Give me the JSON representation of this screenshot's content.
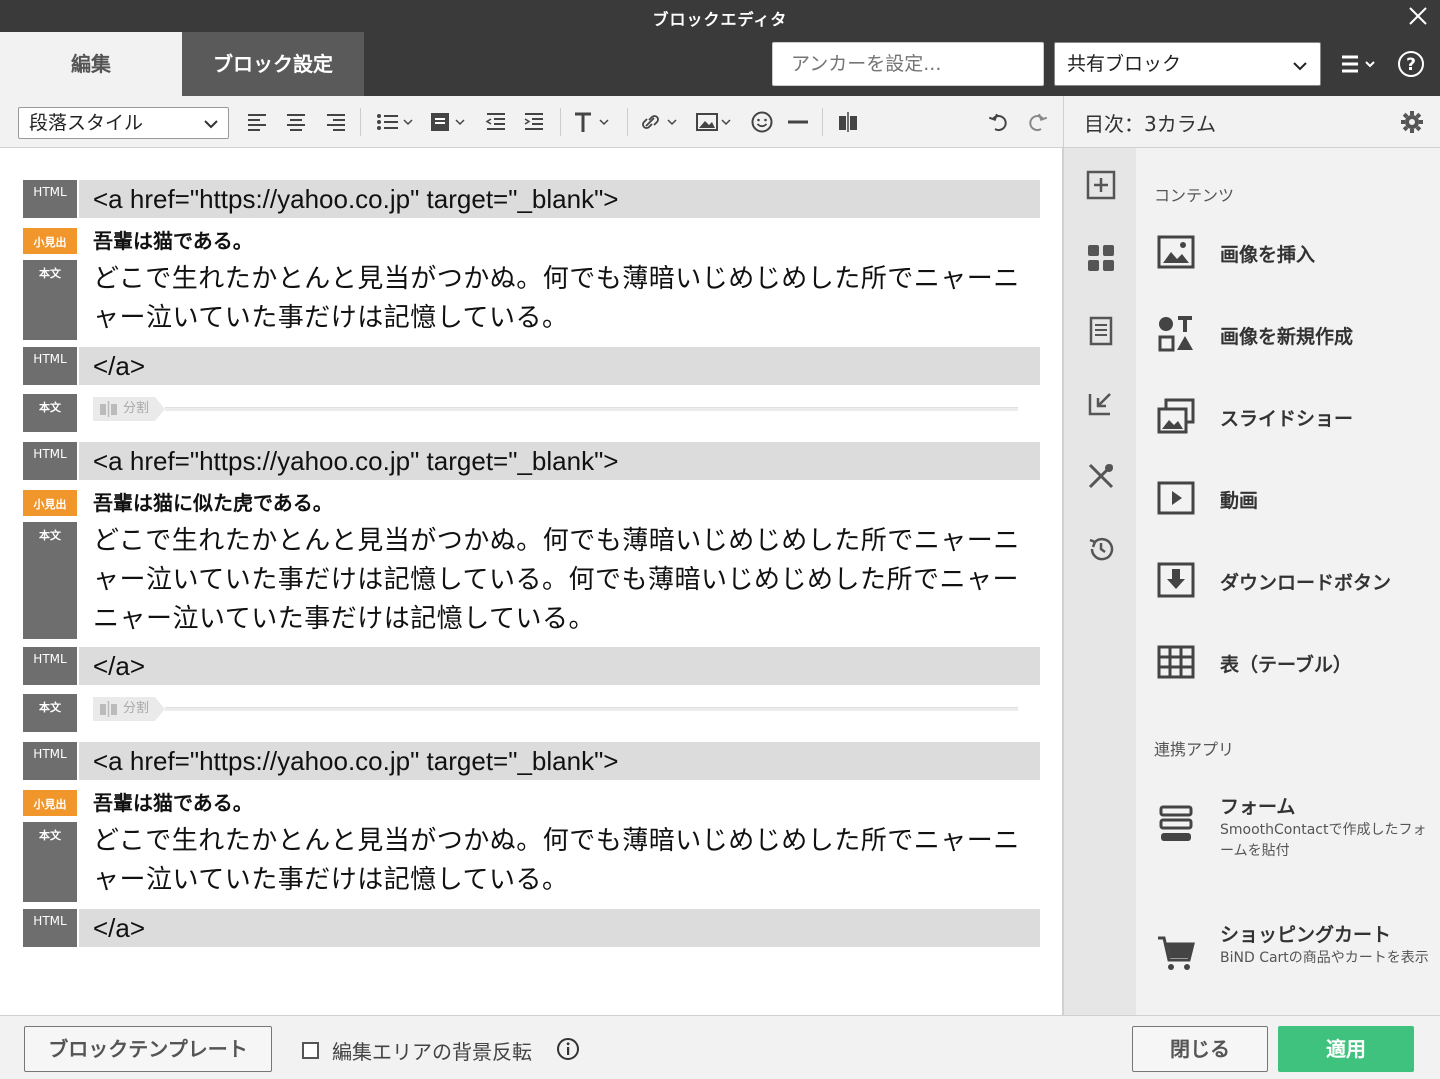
{
  "window": {
    "title": "ブロックエディタ"
  },
  "tabs": {
    "edit": "編集",
    "block_settings": "ブロック設定"
  },
  "anchor": {
    "placeholder": "アンカーを設定..."
  },
  "shared_block": {
    "value": "共有ブロック"
  },
  "toolbar": {
    "paragraph_style": "段落スタイル"
  },
  "right_panel": {
    "header": "目次：3カラム",
    "section_contents": "コンテンツ",
    "items": [
      {
        "label": "画像を挿入",
        "icon": "image-icon"
      },
      {
        "label": "画像を新規作成",
        "icon": "shapes-icon"
      },
      {
        "label": "スライドショー",
        "icon": "slideshow-icon"
      },
      {
        "label": "動画",
        "icon": "video-icon"
      },
      {
        "label": "ダウンロードボタン",
        "icon": "download-icon"
      },
      {
        "label": "表（テーブル）",
        "icon": "table-icon"
      }
    ],
    "section_apps": "連携アプリ",
    "apps": [
      {
        "label": "フォーム",
        "desc": "SmoothContactで作成したフォームを貼付",
        "icon": "form-icon"
      },
      {
        "label": "ショッピングカート",
        "desc": "BiND Cartの商品やカートを表示",
        "icon": "cart-icon"
      }
    ]
  },
  "tags": {
    "html": "HTML",
    "subheading": "小見出",
    "body": "本文",
    "split": "分割"
  },
  "blocks": {
    "a_open": "<a href=\"https://yahoo.co.jp\" target=\"_blank\">",
    "a_close": "</a>",
    "heading1": "吾輩は猫である。",
    "body1": "どこで生れたかとんと見当がつかぬ。何でも薄暗いじめじめした所でニャーニャー泣いていた事だけは記憶している。",
    "heading2": "吾輩は猫に似た虎である。",
    "body2": "どこで生れたかとんと見当がつかぬ。何でも薄暗いじめじめした所でニャーニャー泣いていた事だけは記憶している。何でも薄暗いじめじめした所でニャーニャー泣いていた事だけは記憶している。",
    "heading3": "吾輩は猫である。",
    "body3": "どこで生れたかとんと見当がつかぬ。何でも薄暗いじめじめした所でニャーニャー泣いていた事だけは記憶している。"
  },
  "footer": {
    "template_button": "ブロックテンプレート",
    "invert_bg_label": "編集エリアの背景反転",
    "invert_bg_checked": false,
    "close_button": "閉じる",
    "apply_button": "適用"
  },
  "colors": {
    "accent_green": "#3fc27d",
    "tag_orange": "#f0962a",
    "dark_bar": "#3a3a3a"
  }
}
